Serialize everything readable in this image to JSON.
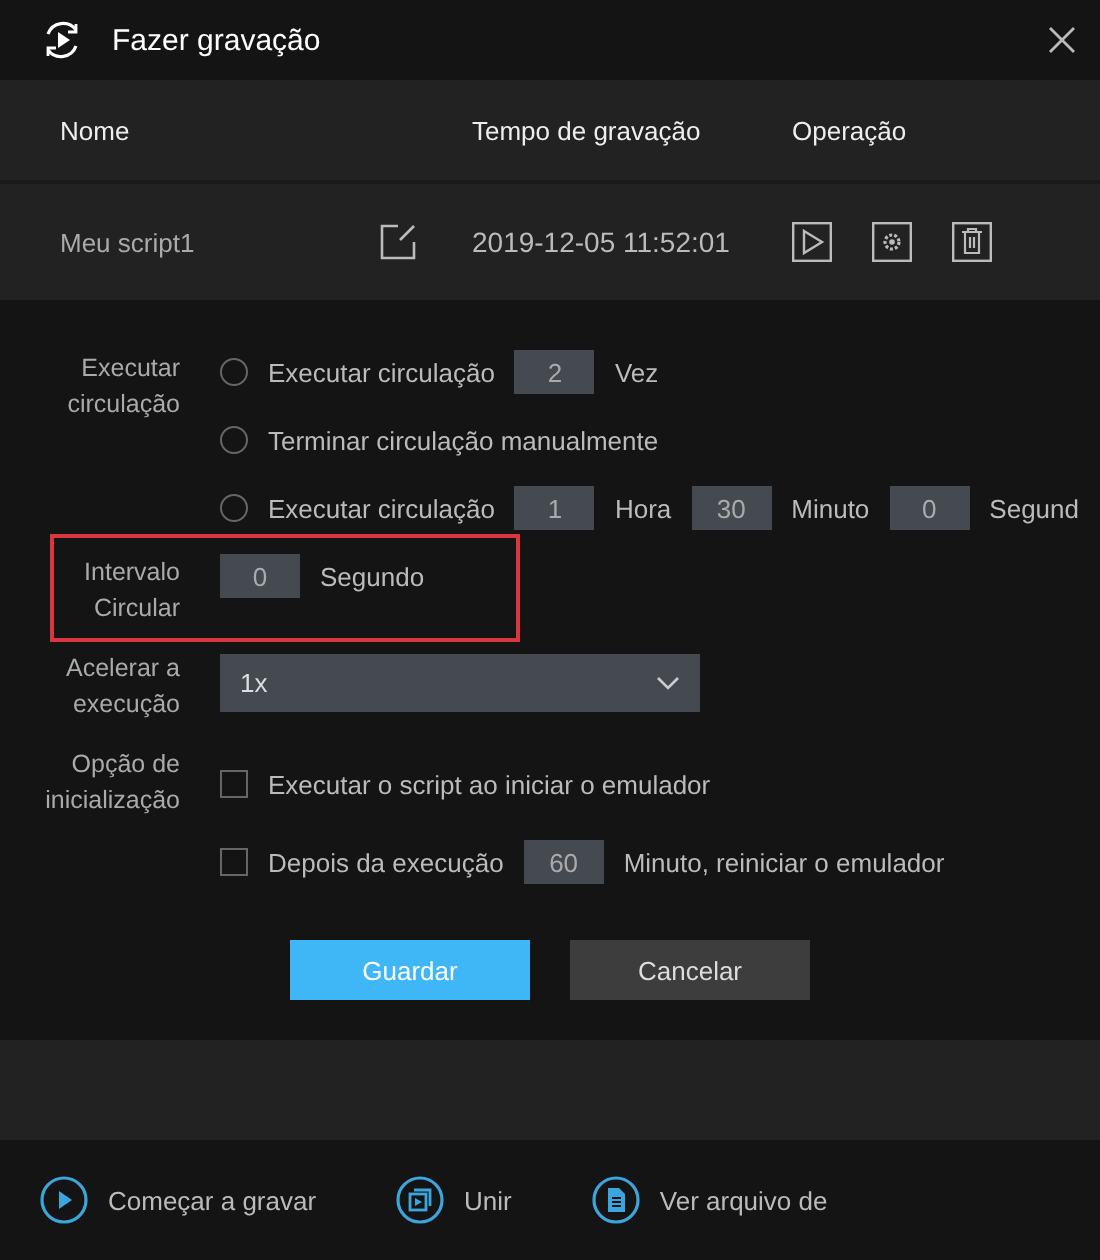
{
  "window": {
    "title": "Fazer gravação"
  },
  "table": {
    "columns": [
      "Nome",
      "Tempo de gravação",
      "Operação"
    ],
    "rows": [
      {
        "name": "Meu script1",
        "time": "2019-12-05 11:52:01"
      }
    ]
  },
  "loop": {
    "label": "Executar circulação",
    "options": [
      {
        "selected": false,
        "parts": [
          {
            "kind": "text",
            "text": "Executar circulação"
          },
          {
            "kind": "field",
            "value": "2"
          },
          {
            "kind": "text",
            "text": "Vez"
          }
        ]
      },
      {
        "selected": false,
        "parts": [
          {
            "kind": "text",
            "text": "Terminar circulação manualmente"
          }
        ]
      },
      {
        "selected": false,
        "parts": [
          {
            "kind": "text",
            "text": "Executar circulação"
          },
          {
            "kind": "field",
            "value": "1"
          },
          {
            "kind": "text",
            "text": "Hora"
          },
          {
            "kind": "field",
            "value": "30"
          },
          {
            "kind": "text",
            "text": "Minuto"
          },
          {
            "kind": "field",
            "value": "0"
          },
          {
            "kind": "text",
            "text": "Segund"
          }
        ]
      }
    ]
  },
  "interval": {
    "label": "Intervalo Circular",
    "highlighted": true,
    "parts": [
      {
        "kind": "field",
        "value": "0"
      },
      {
        "kind": "text",
        "text": "Segundo"
      }
    ]
  },
  "speed": {
    "label": "Acelerar a execução",
    "value": "1x"
  },
  "startup": {
    "label": "Opção de inicialização",
    "options": [
      {
        "checked": false,
        "parts": [
          {
            "kind": "text",
            "text": "Executar o script ao iniciar o emulador"
          }
        ]
      },
      {
        "checked": false,
        "parts": [
          {
            "kind": "text",
            "text": "Depois da execução"
          },
          {
            "kind": "field",
            "value": "60"
          },
          {
            "kind": "text",
            "text": "Minuto, reiniciar o emulador"
          }
        ]
      }
    ]
  },
  "buttons": [
    {
      "label": "Guardar",
      "kind": "primary"
    },
    {
      "label": "Cancelar",
      "kind": "secondary"
    }
  ],
  "footer": [
    "Começar a gravar",
    "Unir",
    "Ver arquivo de"
  ]
}
